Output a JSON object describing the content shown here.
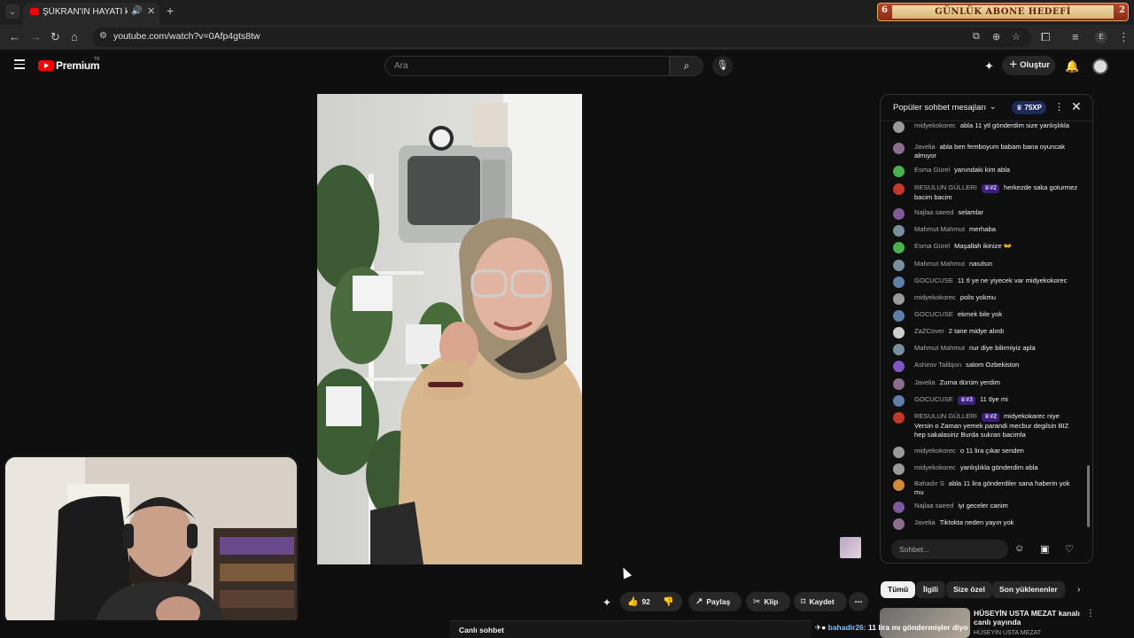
{
  "browser": {
    "tab_title": "ŞÜKRAN'IN HAYATI kanalı c",
    "url": "youtube.com/watch?v=0Afp4gts8tw",
    "profile_initial": "E"
  },
  "banner": {
    "left_count": "6",
    "title": "GÜNLÜK ABONE HEDEFİ",
    "right_count": "2"
  },
  "masthead": {
    "brand": "Premium",
    "region": "TR",
    "search_placeholder": "Ara",
    "create_label": "Oluştur"
  },
  "chat": {
    "title": "Popüler sohbet mesajları",
    "xp": "75XP",
    "input_placeholder": "Sohbet...",
    "messages": [
      {
        "author": "midyekokorec",
        "text": "abla 11 ytl gönderdim size yanlışlıkla",
        "avatar_color": "#9a9a9a",
        "badge": ""
      },
      {
        "author": "Javelia",
        "text": "abla ben femboyum babam bana oyuncak almıyor",
        "avatar_color": "#8a6d8f",
        "badge": ""
      },
      {
        "author": "Esma Gürel",
        "text": "yanındaki kim abla",
        "avatar_color": "#4caf50",
        "badge": ""
      },
      {
        "author": "RESULUN GÜLLERI",
        "text": "herkezde saka goturmez bacim bacim",
        "avatar_color": "#c0392b",
        "badge": "#2"
      },
      {
        "author": "Najlaa saeed",
        "text": "selamlar",
        "avatar_color": "#7e5a9b",
        "badge": ""
      },
      {
        "author": "Mahmut Mahmut",
        "text": "merhaba",
        "avatar_color": "#78909c",
        "badge": ""
      },
      {
        "author": "Esma Gürel",
        "text": "Maşallah ikinize 👐",
        "avatar_color": "#4caf50",
        "badge": ""
      },
      {
        "author": "Mahmut Mahmut",
        "text": "nasılsın",
        "avatar_color": "#78909c",
        "badge": ""
      },
      {
        "author": "GOCUCUSE",
        "text": "11 tl ye ne yiyecek var midyekokorec",
        "avatar_color": "#5d7fa8",
        "badge": ""
      },
      {
        "author": "midyekokorec",
        "text": "polis yokmu",
        "avatar_color": "#9a9a9a",
        "badge": ""
      },
      {
        "author": "GOCUCUSE",
        "text": "ekmek bile yok",
        "avatar_color": "#5d7fa8",
        "badge": ""
      },
      {
        "author": "ZaZCover",
        "text": "2 tane midye alırdı",
        "avatar_color": "#cfcfcf",
        "badge": ""
      },
      {
        "author": "Mahmut Mahmut",
        "text": "nur diye bilirmiyiz apla",
        "avatar_color": "#78909c",
        "badge": ""
      },
      {
        "author": "Ashirov Talibjon",
        "text": "salom Ozbekiston",
        "avatar_color": "#7e57c2",
        "badge": ""
      },
      {
        "author": "Javelia",
        "text": "Zurna dürüm yerdim",
        "avatar_color": "#8a6d8f",
        "badge": ""
      },
      {
        "author": "GOCUCUSE",
        "text": "11 tlye mi",
        "avatar_color": "#5d7fa8",
        "badge": "#3"
      },
      {
        "author": "RESULUN GÜLLERI",
        "text": "midyekokarec niye Versin o Zaman yemek parandi mecbur degilsin BIZ hep sakalasiriz Burda sukran bacimla",
        "avatar_color": "#c0392b",
        "badge": "#2"
      },
      {
        "author": "midyekokorec",
        "text": "o 11 lira çıkar senden",
        "avatar_color": "#9a9a9a",
        "badge": ""
      },
      {
        "author": "midyekokorec",
        "text": "yanlışlıkla gönderdim abla",
        "avatar_color": "#9a9a9a",
        "badge": ""
      },
      {
        "author": "Bahadır S",
        "text": "abla 11 lira gönderdiler sana haberin yok mu",
        "avatar_color": "#d08a3a",
        "badge": ""
      },
      {
        "author": "Najlaa saeed",
        "text": "iyi geceler canim",
        "avatar_color": "#7e5a9b",
        "badge": ""
      },
      {
        "author": "Javelia",
        "text": "Tiktokta neden yayın yok",
        "avatar_color": "#8a6d8f",
        "badge": ""
      }
    ]
  },
  "chips": [
    "Tümü",
    "İlgili",
    "Size özel",
    "Son yüklenenler"
  ],
  "actions": {
    "like_count": "92",
    "share": "Paylaş",
    "clip": "Klip",
    "save": "Kaydet"
  },
  "live_chat_label": "Canlı sohbet",
  "ticker": {
    "name": "bahadir26:",
    "text": " 11 lira mı göndermişler diyo"
  },
  "recommendation": {
    "title": "HÜSEYİN USTA MEZAT kanalı canlı yayında",
    "channel": "HÜSEYİN USTA MEZAT"
  }
}
